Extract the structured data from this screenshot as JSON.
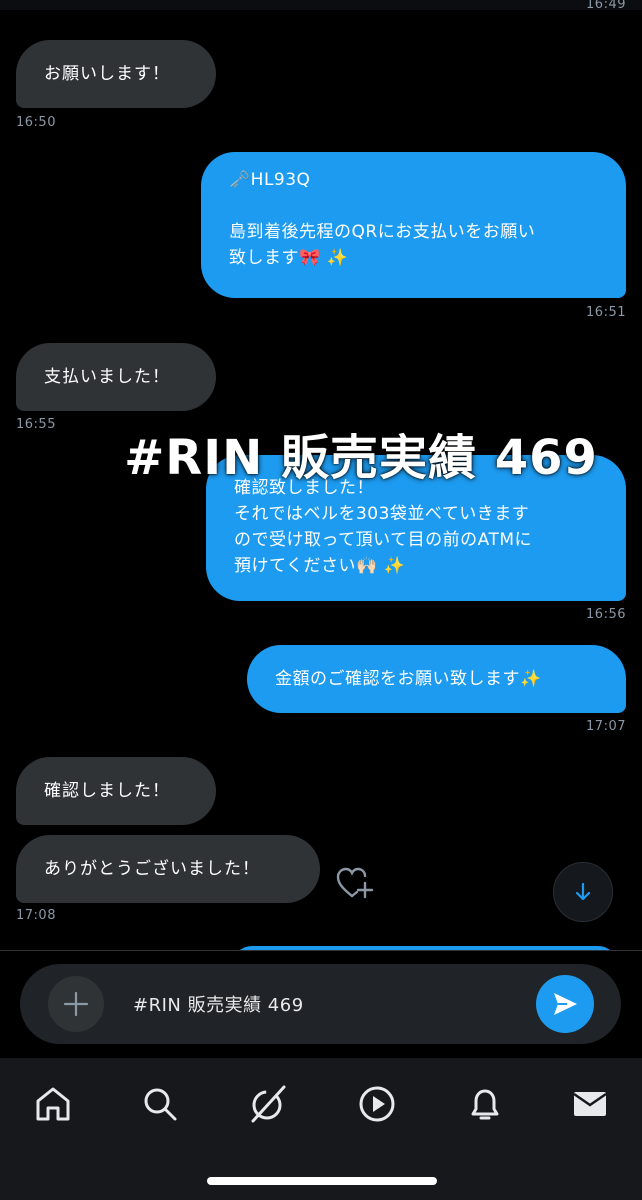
{
  "header": {
    "top_time": "16:49"
  },
  "messages": [
    {
      "id": "m1",
      "side": "in",
      "text": "お願いします！",
      "time": "16:50"
    },
    {
      "id": "m2",
      "side": "out",
      "line1_emoji": "🗝️",
      "line1": "HL93Q",
      "line2": "島到着後先程のQRにお支払いをお願い",
      "line3": "致します",
      "line3_emoji": "🎀 ✨",
      "time": "16:51"
    },
    {
      "id": "m3",
      "side": "in",
      "text": "支払いました！",
      "time": "16:55"
    },
    {
      "id": "m4",
      "side": "out",
      "line1": "確認致しました！",
      "line2": "それではベルを303袋並べていきます",
      "line3": "ので受け取って頂いて目の前のATMに",
      "line4": "預けてください",
      "line4_emoji": "🙌🏻 ✨",
      "time": "16:56"
    },
    {
      "id": "m5",
      "side": "out",
      "text": "金額のご確認をお願い致します",
      "text_emoji": "✨",
      "time": "17:07"
    },
    {
      "id": "m6",
      "side": "in",
      "text": "確認しました！"
    },
    {
      "id": "m7",
      "side": "in",
      "text": "ありがとうございました！",
      "time": "17:08"
    }
  ],
  "overlay": {
    "caption": "#RIN 販売実績 469"
  },
  "composer": {
    "value": "#RIN 販売実績 469"
  },
  "colors": {
    "accent": "#1d9bf0",
    "incoming_bubble": "#2f3336",
    "background": "#000000"
  },
  "icons": {
    "react": "heart-plus-icon",
    "scroll": "arrow-down-icon",
    "add": "plus-icon",
    "send": "send-icon",
    "tabs": [
      "home-icon",
      "search-icon",
      "grok-icon",
      "play-icon",
      "bell-icon",
      "mail-icon"
    ]
  }
}
